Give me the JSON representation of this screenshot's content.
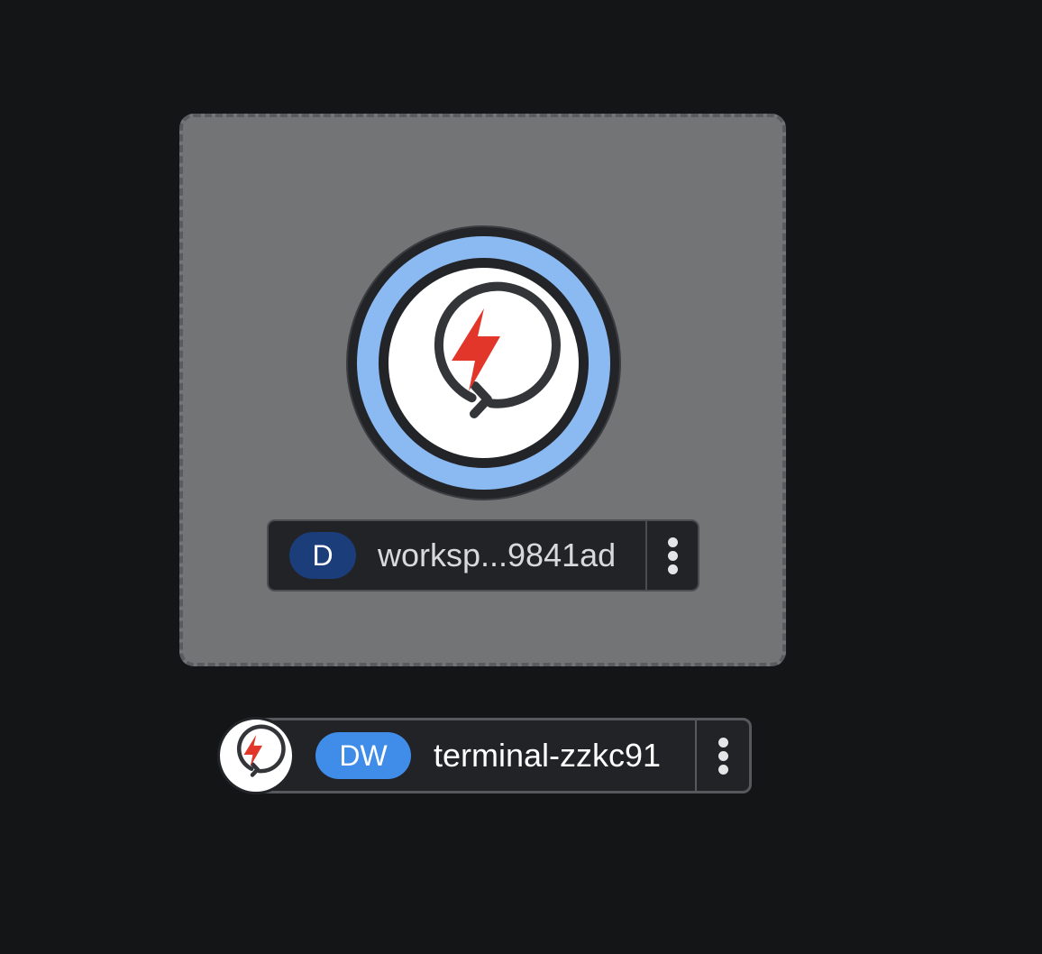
{
  "group": {
    "node_icon": "lightning-refresh-icon",
    "label_badge": "D",
    "label_text": "worksp...9841ad",
    "menu_icon": "kebab-menu-icon",
    "colors": {
      "group_fill": "#737476",
      "ring": "#8bbaf2",
      "badge": "#1b3d7a",
      "bolt": "#e2362b"
    }
  },
  "terminal": {
    "node_icon": "lightning-refresh-icon",
    "label_badge": "DW",
    "label_text": "terminal-zzkc91",
    "menu_icon": "kebab-menu-icon",
    "colors": {
      "badge": "#3f8ce9"
    }
  }
}
